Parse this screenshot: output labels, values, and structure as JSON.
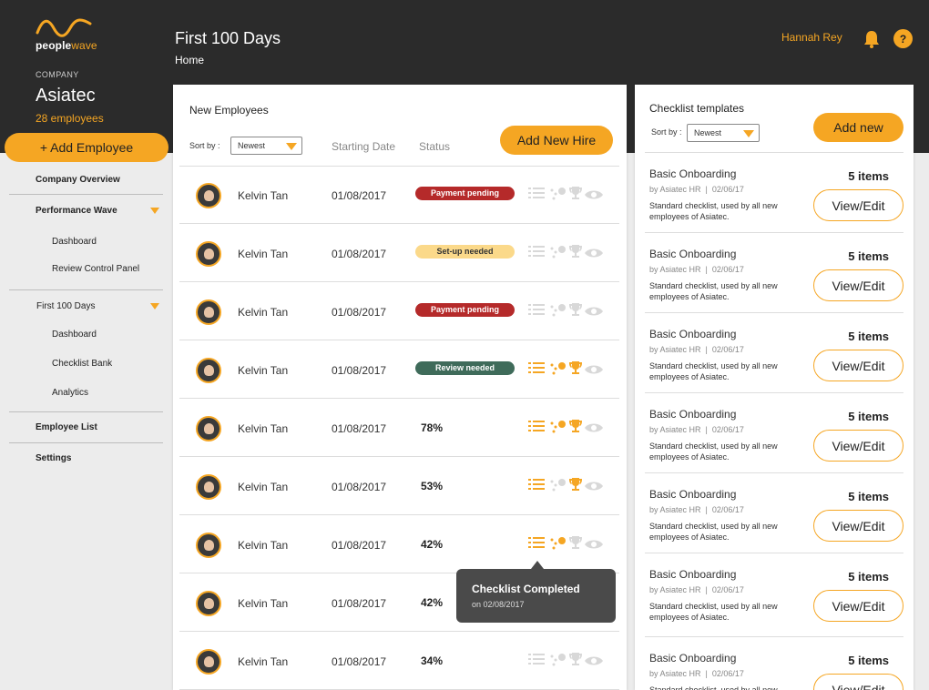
{
  "brand": {
    "logo_text_a": "people",
    "logo_text_b": "wave",
    "accent": "#f5a623",
    "dark": "#2b2b2b"
  },
  "sidebar": {
    "company_label": "COMPANY",
    "company_name": "Asiatec",
    "employee_count": "28 employees",
    "add_employee": "+ Add Employee",
    "nav": {
      "company_overview": "Company Overview",
      "performance_wave": "Performance Wave",
      "pw_dashboard": "Dashboard",
      "pw_review": "Review Control Panel",
      "first_100": "First 100 Days",
      "f100_dashboard": "Dashboard",
      "f100_checklist": "Checklist Bank",
      "f100_analytics": "Analytics",
      "employee_list": "Employee List",
      "settings": "Settings"
    }
  },
  "header": {
    "title": "First 100 Days",
    "breadcrumb": "Home",
    "user_name": "Hannah Rey",
    "help": "?"
  },
  "new_employees": {
    "title": "New Employees",
    "sort_label": "Sort by :",
    "sort_value": "Newest",
    "col_date": "Starting Date",
    "col_status": "Status",
    "add_button": "Add New Hire",
    "rows": [
      {
        "name": "Kelvin Tan",
        "date": "01/08/2017",
        "status": "Payment pending",
        "kind": "pay",
        "icons": [
          0,
          0,
          0,
          0
        ]
      },
      {
        "name": "Kelvin Tan",
        "date": "01/08/2017",
        "status": "Set-up needed",
        "kind": "setup",
        "icons": [
          0,
          0,
          0,
          0
        ]
      },
      {
        "name": "Kelvin Tan",
        "date": "01/08/2017",
        "status": "Payment pending",
        "kind": "pay",
        "icons": [
          0,
          0,
          0,
          0
        ]
      },
      {
        "name": "Kelvin Tan",
        "date": "01/08/2017",
        "status": "Review needed",
        "kind": "review",
        "icons": [
          1,
          1,
          1,
          0
        ]
      },
      {
        "name": "Kelvin Tan",
        "date": "01/08/2017",
        "status": "78%",
        "kind": "pct",
        "icons": [
          1,
          1,
          1,
          0
        ]
      },
      {
        "name": "Kelvin Tan",
        "date": "01/08/2017",
        "status": "53%",
        "kind": "pct",
        "icons": [
          1,
          0,
          1,
          0
        ]
      },
      {
        "name": "Kelvin Tan",
        "date": "01/08/2017",
        "status": "42%",
        "kind": "pct",
        "icons": [
          1,
          1,
          0,
          0
        ]
      },
      {
        "name": "Kelvin Tan",
        "date": "01/08/2017",
        "status": "42%",
        "kind": "pct",
        "icons": [
          0,
          0,
          0,
          0
        ]
      },
      {
        "name": "Kelvin Tan",
        "date": "01/08/2017",
        "status": "34%",
        "kind": "pct",
        "icons": [
          0,
          0,
          0,
          0
        ]
      }
    ],
    "icon_names": [
      "list-icon",
      "milestone-icon",
      "trophy-icon",
      "eye-icon"
    ]
  },
  "tooltip": {
    "title": "Checklist Completed",
    "sub": "on 02/08/2017"
  },
  "checklist_templates": {
    "title": "Checklist templates",
    "sort_label": "Sort by :",
    "sort_value": "Newest",
    "add_button": "Add new",
    "items": [
      {
        "name": "Basic Onboarding",
        "author": "by Asiatec HR",
        "date": "02/06/17",
        "desc": "Standard checklist, used by all new employees of Asiatec.",
        "count": "5 items",
        "action": "View/Edit"
      },
      {
        "name": "Basic Onboarding",
        "author": "by Asiatec HR",
        "date": "02/06/17",
        "desc": "Standard checklist, used by all new employees of Asiatec.",
        "count": "5 items",
        "action": "View/Edit"
      },
      {
        "name": "Basic Onboarding",
        "author": "by Asiatec HR",
        "date": "02/06/17",
        "desc": "Standard checklist, used by all new employees of Asiatec.",
        "count": "5 items",
        "action": "View/Edit"
      },
      {
        "name": "Basic Onboarding",
        "author": "by Asiatec HR",
        "date": "02/06/17",
        "desc": "Standard checklist, used by all new employees of Asiatec.",
        "count": "5 items",
        "action": "View/Edit"
      },
      {
        "name": "Basic Onboarding",
        "author": "by Asiatec HR",
        "date": "02/06/17",
        "desc": "Standard checklist, used by all new employees of Asiatec.",
        "count": "5 items",
        "action": "View/Edit"
      },
      {
        "name": "Basic Onboarding",
        "author": "by Asiatec HR",
        "date": "02/06/17",
        "desc": "Standard checklist, used by all new employees of Asiatec.",
        "count": "5 items",
        "action": "View/Edit"
      },
      {
        "name": "Basic Onboarding",
        "author": "by Asiatec HR",
        "date": "02/06/17",
        "desc": "Standard checklist, used by all new employees of Asiatec.",
        "count": "5 items",
        "action": "View/Edit"
      }
    ]
  }
}
